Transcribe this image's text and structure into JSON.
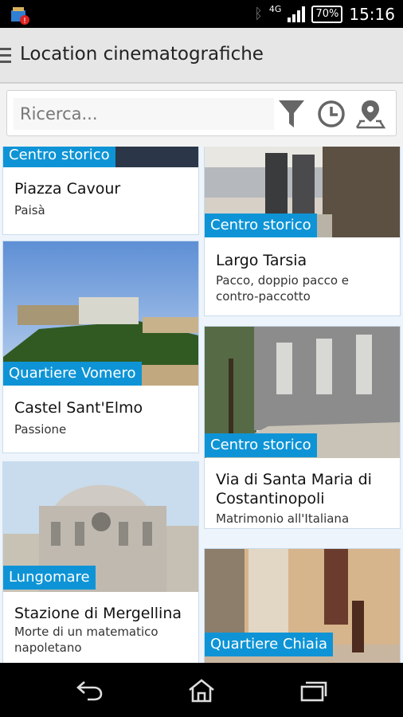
{
  "status_bar": {
    "network": "4G",
    "battery": "70%",
    "time": "15:16"
  },
  "action_bar": {
    "title": "Location cinematografiche"
  },
  "search": {
    "placeholder": "Ricerca..."
  },
  "icons": {
    "menu": "hamburger-icon",
    "filter": "filter-funnel-icon",
    "history": "clock-icon",
    "map": "map-pin-icon",
    "back": "back-arrow-icon",
    "home": "home-icon",
    "recents": "recent-apps-icon"
  },
  "colors": {
    "category_badge": "#0e94d6",
    "action_bar": "#e6e6e6",
    "background": "#eef4fb"
  },
  "cards": [
    {
      "category": "Centro storico",
      "title": "Piazza Cavour",
      "film": "Paisà"
    },
    {
      "category": "Centro storico",
      "title": "Largo Tarsia",
      "film": "Pacco, doppio pacco e contro-paccotto"
    },
    {
      "category": "Quartiere Vomero",
      "title": "Castel Sant'Elmo",
      "film": "Passione"
    },
    {
      "category": "Centro storico",
      "title": "Via di Santa Maria di Costantinopoli",
      "film": "Matrimonio all'Italiana"
    },
    {
      "category": "Lungomare",
      "title": "Stazione di Mergellina",
      "film": "Morte di un matematico napoletano"
    },
    {
      "category": "Quartiere Chiaia",
      "title": "",
      "film": ""
    }
  ]
}
